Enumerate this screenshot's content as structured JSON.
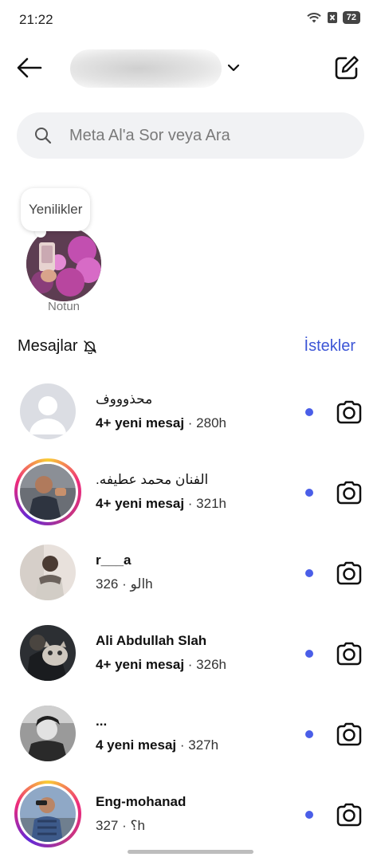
{
  "status_bar": {
    "time": "21:22",
    "battery": "72"
  },
  "header": {
    "account_name": "",
    "back_icon": "arrow-left-icon",
    "compose_icon": "compose-icon"
  },
  "search": {
    "placeholder": "Meta Al'a Sor veya Ara"
  },
  "notes": {
    "bubble": "Yenilikler",
    "label": "Notun"
  },
  "messages": {
    "title": "Mesajlar",
    "requests": "İstekler"
  },
  "threads": [
    {
      "name": "محذوووف",
      "prefix": "",
      "sub_bold": "4+ yeni mesaj",
      "time": "280h"
    },
    {
      "name": "الفنان محمد عطيفه.",
      "prefix": "",
      "sub_bold": "4+ yeni mesaj",
      "time": "321h"
    },
    {
      "name": "r___a",
      "prefix": "الو",
      "sub_bold": "",
      "time": "326h"
    },
    {
      "name": "Ali Abdullah Slah",
      "prefix": "",
      "sub_bold": "4+ yeni mesaj",
      "time": "326h"
    },
    {
      "name": "...",
      "prefix": "",
      "sub_bold": "4 yeni mesaj",
      "time": "327h"
    },
    {
      "name": "Eng-mohanad",
      "prefix": "؟",
      "sub_bold": "",
      "time": "327h"
    }
  ],
  "colors": {
    "accent": "#3d56d6",
    "unread_dot": "#4a5ee8",
    "search_bg": "#f1f2f4"
  }
}
